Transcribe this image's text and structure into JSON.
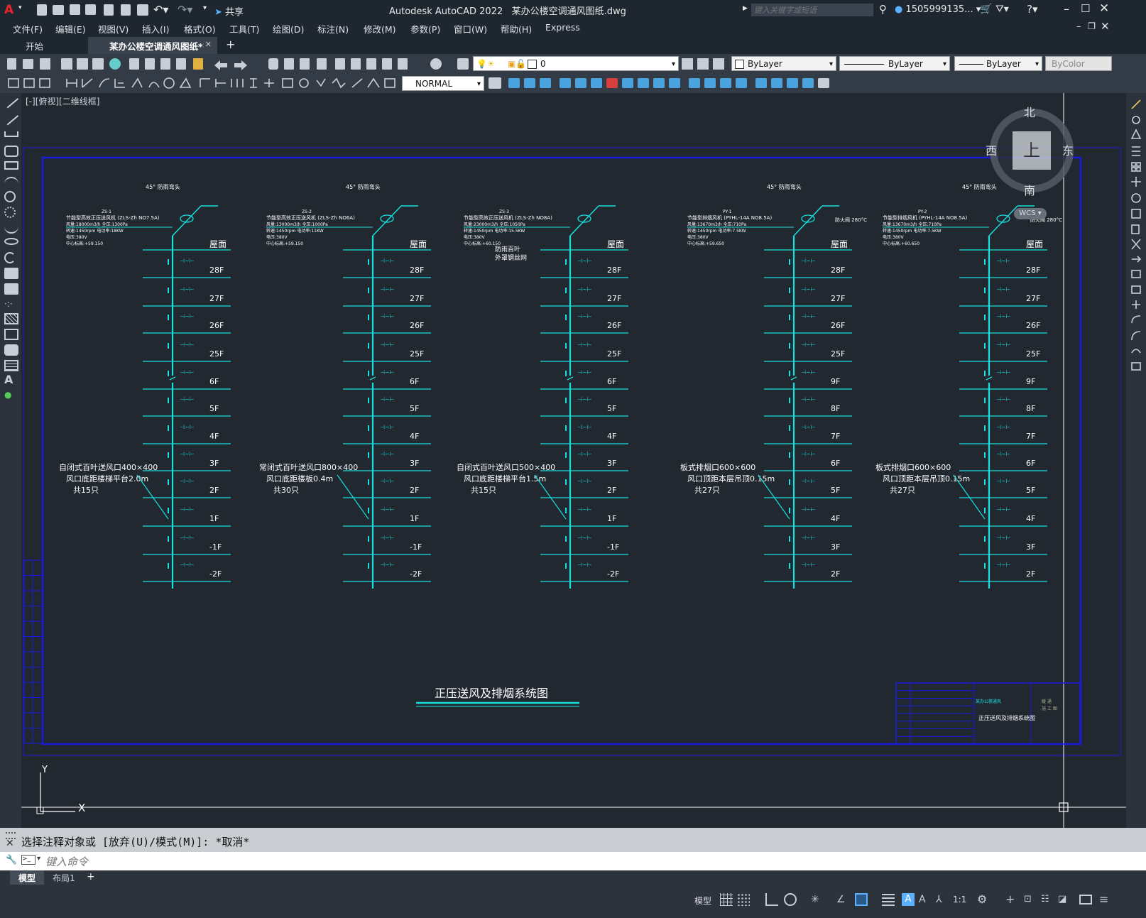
{
  "app": {
    "title": "Autodesk AutoCAD 2022",
    "file_name": "某办公楼空调通风图纸.dwg",
    "search_placeholder": "键入关键字或短语",
    "user": "1505999135...",
    "share_label": "共享"
  },
  "menu": [
    "文件(F)",
    "编辑(E)",
    "视图(V)",
    "插入(I)",
    "格式(O)",
    "工具(T)",
    "绘图(D)",
    "标注(N)",
    "修改(M)",
    "参数(P)",
    "窗口(W)",
    "帮助(H)",
    "Express"
  ],
  "tabs": [
    {
      "label": "开始"
    },
    {
      "label": "某办公楼空调通风图纸*"
    }
  ],
  "toolbar": {
    "layer_value": "0",
    "color_value": "ByLayer",
    "linetype_value": "ByLayer",
    "lineweight_value": "ByLayer",
    "plotstyle_value": "ByColor",
    "textstyle_value": "NORMAL"
  },
  "viewport": {
    "label": "[-][俯视][二维线框]",
    "viewcube": {
      "top": "上",
      "north": "北",
      "south": "南",
      "west": "西",
      "east": "东",
      "wcs": "WCS"
    }
  },
  "drawing": {
    "title": "正压送风及排烟系统图",
    "ucs_x": "X",
    "ucs_y": "Y",
    "columns": [
      {
        "id": "c1",
        "top_note": "45°  防雨弯头",
        "equip": [
          "ZS-1",
          "节能型高效正压送风机 (ZLS-Zh NO7.5A)",
          "风量:18000m3/h  全压:1300Pa",
          "转速:1450rpm   电功率:18KW",
          "电压:380V",
          "中心标高:+59.150"
        ],
        "roof": "屋面",
        "upper": [
          "28F",
          "27F",
          "26F",
          "25F"
        ],
        "lower": [
          "6F",
          "5F",
          "4F",
          "3F",
          "2F",
          "1F",
          "-1F",
          "-2F"
        ],
        "note": [
          "自闭式百叶送风口400×400",
          "风口底距楼梯平台2.0m",
          "共15只"
        ]
      },
      {
        "id": "c2",
        "top_note": "45°  防雨弯头",
        "equip": [
          "ZS-2",
          "节能型高效正压送风机 (ZLS-Zh NO6A)",
          "风量:13000m3/h  全压:1000Pa",
          "转速:1450rpm   电功率:11KW",
          "电压:380V",
          "中心标高:+59.150"
        ],
        "roof": "屋面",
        "upper": [
          "28F",
          "27F",
          "26F",
          "25F"
        ],
        "lower": [
          "6F",
          "5F",
          "4F",
          "3F",
          "2F",
          "1F",
          "-1F",
          "-2F"
        ],
        "note": [
          "常闭式百叶送风口800×400",
          "风口底距楼板0.4m",
          "共30只"
        ]
      },
      {
        "id": "c3",
        "top_note": "",
        "equip": [
          "ZS-3",
          "节能型高效正压送风机 (ZLS-Zh NO8A)",
          "风量:23000m3/h  全压:1050Pa",
          "转速:1450rpm   电功率:15.5KW",
          "电压:380V",
          "中心标高:+60.150"
        ],
        "side_note": [
          "防雨百叶",
          "外罩钢丝网"
        ],
        "roof": "屋面",
        "upper": [
          "28F",
          "27F",
          "26F",
          "25F"
        ],
        "lower": [
          "6F",
          "5F",
          "4F",
          "3F",
          "2F",
          "1F",
          "-1F",
          "-2F"
        ],
        "note": [
          "自闭式百叶送风口500×400",
          "风口底距楼梯平台1.5m",
          "共15只"
        ]
      },
      {
        "id": "c4",
        "top_note": "45°  防雨弯头",
        "equip": [
          "PY-1",
          "节能型排烟风机 (PYHL-14A NO8.5A)",
          "风量:13670m3/h  全压:710Pa",
          "转速:1450rpm   电功率:7.5KW",
          "电压:380V",
          "中心标高:+59.650"
        ],
        "damper": "防火阀 280°C",
        "roof": "屋面",
        "upper": [
          "28F",
          "27F",
          "26F",
          "25F"
        ],
        "lower": [
          "9F",
          "8F",
          "7F",
          "6F",
          "5F",
          "4F",
          "3F",
          "2F"
        ],
        "note": [
          "板式排烟口600×600",
          "风口顶距本层吊顶0.15m",
          "共27只"
        ]
      },
      {
        "id": "c5",
        "top_note": "45°  防雨弯头",
        "equip": [
          "PY-2",
          "节能型排烟风机 (PYHL-14A NO8.5A)",
          "风量:13670m3/h  全压:710Pa",
          "转速:1450rpm   电功率:7.5KW",
          "电压:380V",
          "中心标高:+60.650"
        ],
        "damper": "防火阀 280°C",
        "roof": "屋面",
        "upper": [
          "28F",
          "27F",
          "26F",
          "25F"
        ],
        "lower": [
          "9F",
          "8F",
          "7F",
          "6F",
          "5F",
          "4F",
          "3F",
          "2F"
        ],
        "note": [
          "板式排烟口600×600",
          "风口顶距本层吊顶0.15m",
          "共27只"
        ]
      }
    ],
    "titleblock": {
      "name": "正压送风及排烟系统图",
      "small1": "某办公楼通风",
      "small2": "暖  通",
      "small3": "施 工 图"
    }
  },
  "command": {
    "history": "选择注释对象或 [放弃(U)/模式(M)]: *取消*",
    "placeholder": "键入命令"
  },
  "layout_tabs": [
    "模型",
    "布局1"
  ],
  "status": {
    "model": "模型",
    "scale": "1:1"
  },
  "colors": {
    "cyan": "#19e0e0",
    "blue": "#1a1adf",
    "bg": "#212830",
    "white": "#ffffff"
  }
}
